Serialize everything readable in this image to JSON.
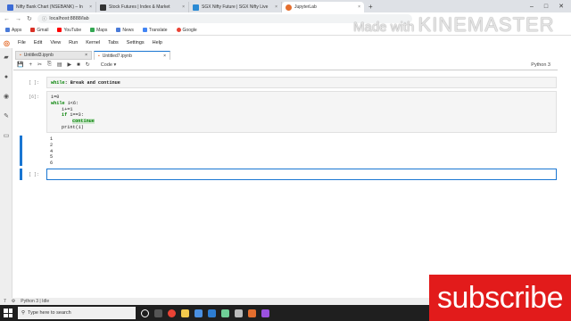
{
  "browser": {
    "tabs": [
      {
        "label": "Nifty Bank Chart (NSEBANK) – In",
        "color": "#3b6bd6"
      },
      {
        "label": "Stock Futures | Index & Market",
        "color": "#333333"
      },
      {
        "label": "SGX Nifty Future | SGX Nifty Live",
        "color": "#2a8ad4"
      },
      {
        "label": "JupyterLab",
        "color": "#e46e2e"
      }
    ],
    "new_tab": "+",
    "url": "localhost:8888/lab",
    "bookmarks": [
      {
        "label": "Apps",
        "color": "#4a7bd8"
      },
      {
        "label": "Gmail",
        "color": "#d93025"
      },
      {
        "label": "YouTube",
        "color": "#ff0000"
      },
      {
        "label": "Maps",
        "color": "#34a853"
      },
      {
        "label": "News",
        "color": "#4a7bd8"
      },
      {
        "label": "Translate",
        "color": "#4285f4"
      },
      {
        "label": "Google",
        "color": "#ea4335"
      }
    ]
  },
  "watermark": {
    "small": "Made with",
    "big": "KINEMASTER"
  },
  "menu": [
    "File",
    "Edit",
    "View",
    "Run",
    "Kernel",
    "Tabs",
    "Settings",
    "Help"
  ],
  "doc_tabs": [
    {
      "label": "Untitled3.ipynb"
    },
    {
      "label": "Untitled7.ipynb"
    }
  ],
  "toolbar": {
    "cell_type": "Code",
    "kernel": "Python 3"
  },
  "cells": {
    "c1": {
      "prompt": "[ ]:",
      "title_kw1": "while",
      "title_rest": ": Break and continue"
    },
    "c2": {
      "prompt": "[6]:",
      "l1": "i=0",
      "l2_kw": "while",
      "l2_rest": " i<6:",
      "l3": "i+=1",
      "l4_kw": "if",
      "l4_rest": " i==3:",
      "l5": "continue",
      "l6": "print(i)"
    },
    "outputs": [
      "1",
      "2",
      "4",
      "5",
      "6"
    ],
    "c3": {
      "prompt": "[ ]:"
    }
  },
  "status": {
    "mode": "7",
    "kernel": "Python 3 | Idle"
  },
  "taskbar": {
    "search_placeholder": "Type here to search"
  },
  "overlay": {
    "subscribe": "subscribe"
  }
}
